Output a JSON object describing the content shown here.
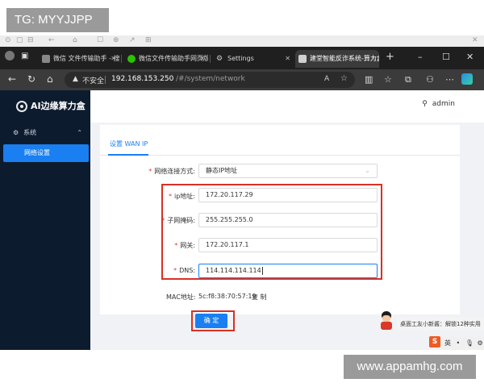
{
  "watermark_top": "TG: MYYJJPP",
  "watermark_bottom": "www.appamhg.com",
  "browser": {
    "tabs": [
      {
        "label": "微信 文件传输助手 - 搜索"
      },
      {
        "label": "微信文件传输助手网页版"
      },
      {
        "label": "Settings"
      },
      {
        "label": "建堂智能反诈系统-算力盒"
      }
    ],
    "new_tab": "+",
    "window_controls": {
      "minimize": "–",
      "maximize": "☐",
      "close": "✕"
    },
    "address": {
      "insecure_label": "不安全",
      "host": "192.168.153.250",
      "path": "/#/system/network"
    }
  },
  "app": {
    "logo_text": "AI边缘算力盒",
    "user": "admin",
    "sidebar": {
      "group_label": "系统",
      "item_label": "网络设置"
    },
    "tab_label": "设置 WAN IP",
    "form": {
      "connection_label": "网络连接方式:",
      "connection_value": "静态IP地址",
      "ip_label": "ip地址:",
      "ip_value": "172.20.117.29",
      "mask_label": "子网掩码:",
      "mask_value": "255.255.255.0",
      "gateway_label": "网关:",
      "gateway_value": "172.20.117.1",
      "dns_label": "DNS:",
      "dns_value": "114.114.114.114",
      "mac_label": "MAC地址:",
      "mac_value": "5c:f8:38:70:57:19",
      "copy_label": "复 制",
      "confirm_label": "确 定"
    }
  },
  "overlay": {
    "toast": "桌面工友小新酱：解锁12种实用",
    "ime": "英"
  },
  "colors": {
    "accent": "#1a7ff0",
    "sidebar_bg": "#0d1b2f",
    "highlight": "#d93025"
  }
}
